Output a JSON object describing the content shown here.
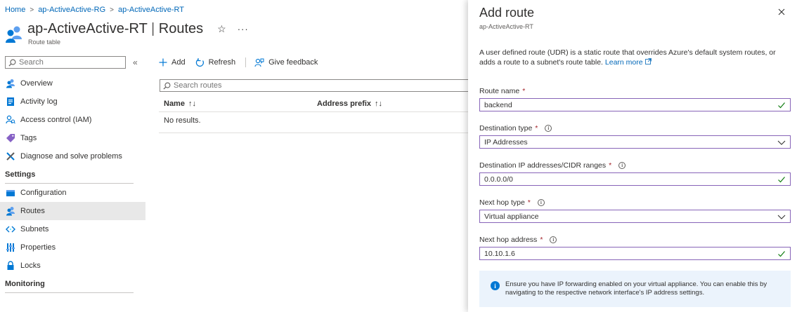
{
  "breadcrumb": {
    "items": [
      "Home",
      "ap-ActiveActive-RG",
      "ap-ActiveActive-RT"
    ],
    "separator": ">"
  },
  "header": {
    "title_name": "ap-ActiveActive-RT",
    "title_sep": "|",
    "title_section": "Routes",
    "subtitle": "Route table",
    "star_icon": "☆",
    "more_icon": "···"
  },
  "sidebar": {
    "search_placeholder": "Search",
    "collapse_icon": "«",
    "items": [
      {
        "label": "Overview",
        "icon": "people-icon"
      },
      {
        "label": "Activity log",
        "icon": "log-icon"
      },
      {
        "label": "Access control (IAM)",
        "icon": "iam-icon"
      },
      {
        "label": "Tags",
        "icon": "tag-icon"
      },
      {
        "label": "Diagnose and solve problems",
        "icon": "wrench-icon"
      }
    ],
    "settings_header": "Settings",
    "settings_items": [
      {
        "label": "Configuration",
        "icon": "config-icon"
      },
      {
        "label": "Routes",
        "icon": "routes-icon",
        "active": true
      },
      {
        "label": "Subnets",
        "icon": "subnet-icon"
      },
      {
        "label": "Properties",
        "icon": "properties-icon"
      },
      {
        "label": "Locks",
        "icon": "lock-icon"
      }
    ],
    "monitoring_header": "Monitoring"
  },
  "toolbar": {
    "add_label": "Add",
    "refresh_label": "Refresh",
    "feedback_label": "Give feedback"
  },
  "routes": {
    "search_placeholder": "Search routes",
    "columns": [
      "Name",
      "Address prefix"
    ],
    "sort_icon": "↑↓",
    "empty_text": "No results."
  },
  "blade": {
    "title": "Add route",
    "subtitle": "ap-ActiveActive-RT",
    "description": "A user defined route (UDR) is a static route that overrides Azure's default system routes, or adds a route to a subnet's route table.",
    "learn_more": "Learn more",
    "fields": {
      "route_name": {
        "label": "Route name",
        "value": "backend"
      },
      "destination_type": {
        "label": "Destination type",
        "value": "IP Addresses"
      },
      "destination_ip": {
        "label": "Destination IP addresses/CIDR ranges",
        "value": "0.0.0.0/0"
      },
      "next_hop_type": {
        "label": "Next hop type",
        "value": "Virtual appliance"
      },
      "next_hop_address": {
        "label": "Next hop address",
        "value": "10.10.1.6"
      }
    },
    "required_mark": "*",
    "info_text": "Ensure you have IP forwarding enabled on your virtual appliance. You can enable this by navigating to the respective network interface's IP address settings."
  },
  "colors": {
    "link": "#0067b8",
    "valid_border": "#8764b8",
    "check": "#107c10",
    "info_bg": "#ebf3fc",
    "info_icon": "#0078d4",
    "active_nav": "#e8e8e8"
  }
}
